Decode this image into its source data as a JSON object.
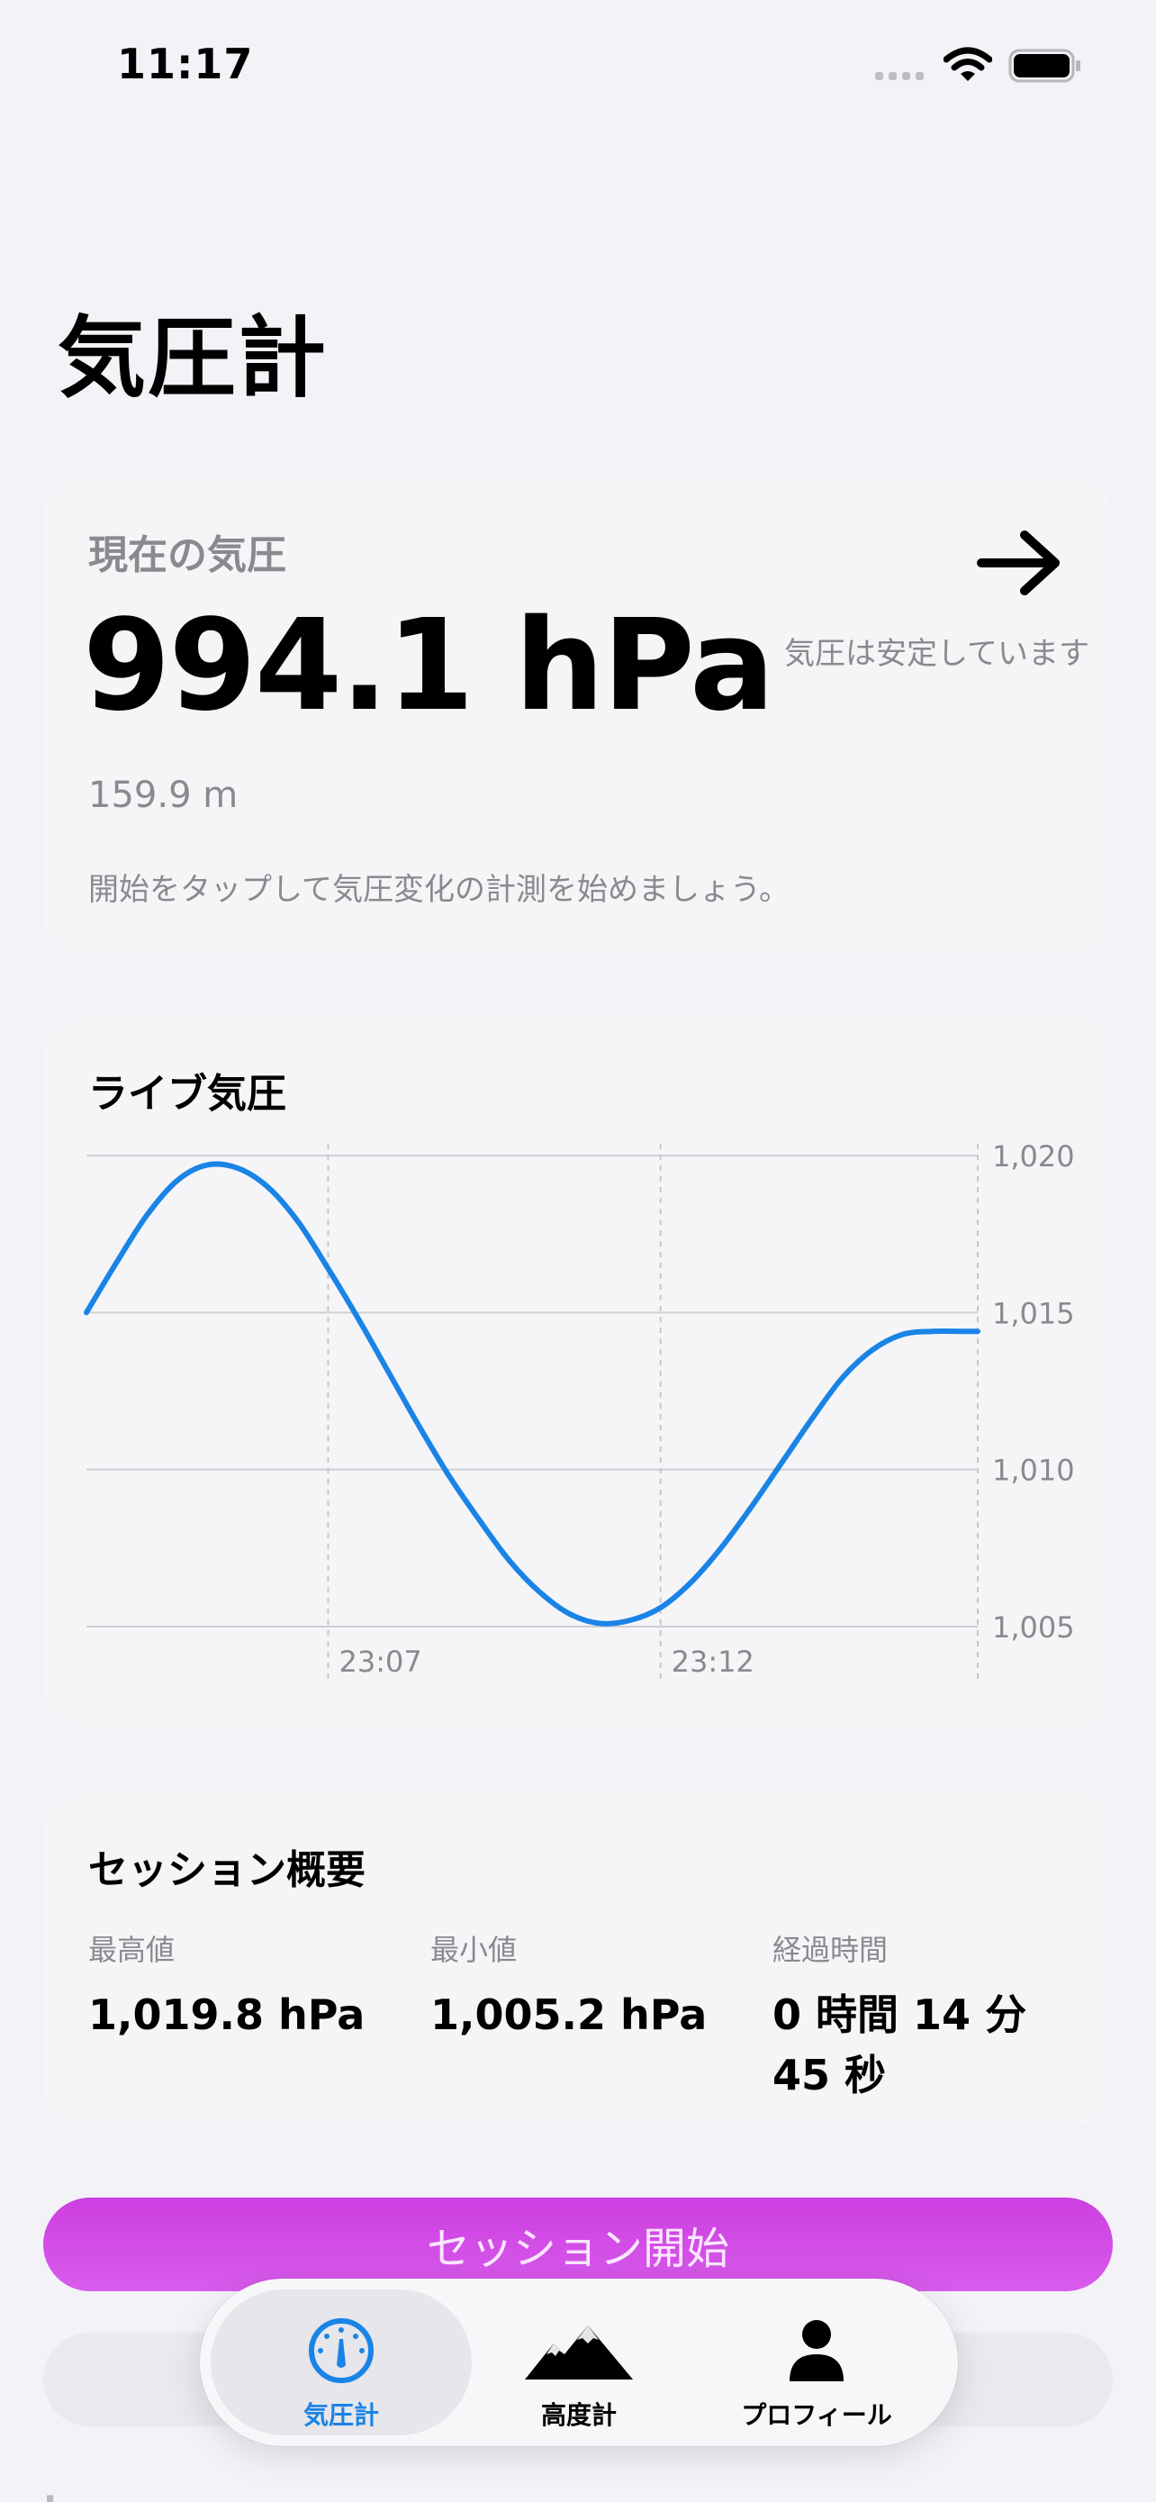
{
  "status_bar": {
    "time": "11:17"
  },
  "page_title": "気圧計",
  "current_card": {
    "label": "現在の気圧",
    "value": "994.1 hPa",
    "altitude": "159.9 m",
    "hint": "開始をタップして気圧変化の計測を始めましょう。",
    "trend_text": "気圧は安定しています",
    "trend_icon": "arrow-right-icon"
  },
  "live_card": {
    "title": "ライブ気圧"
  },
  "chart_data": {
    "type": "line",
    "title": "ライブ気圧",
    "x_tick_labels": [
      "23:07",
      "23:12"
    ],
    "y_ticks": [
      1005,
      1010,
      1015,
      1020
    ],
    "y_tick_labels": [
      "1,005",
      "1,010",
      "1,015",
      "1,020"
    ],
    "ylim": [
      1005,
      1020
    ],
    "grid": true,
    "series_color": "#1a84e6",
    "series": [
      {
        "x": [
          0,
          0.5,
          1,
          1.5,
          2,
          2.5,
          3,
          3.5,
          4,
          4.5,
          5,
          5.5,
          6,
          6.5,
          7,
          7.5,
          8,
          8.5,
          9,
          9.5,
          10,
          10.5,
          11,
          11.5,
          12,
          12.5,
          13,
          13.5,
          14,
          14.5,
          14.75
        ],
        "y": [
          1015.0,
          1016.6,
          1018.1,
          1019.2,
          1019.7,
          1019.6,
          1019.0,
          1017.9,
          1016.4,
          1014.8,
          1013.1,
          1011.4,
          1009.8,
          1008.4,
          1007.1,
          1006.1,
          1005.4,
          1005.1,
          1005.2,
          1005.6,
          1006.4,
          1007.5,
          1008.8,
          1010.2,
          1011.6,
          1012.9,
          1013.8,
          1014.3,
          1014.4,
          1014.4,
          1014.4
        ]
      }
    ]
  },
  "summary_card": {
    "title": "セッション概要",
    "stats": [
      {
        "label": "最高値",
        "value": "1,019.8 hPa"
      },
      {
        "label": "最小値",
        "value": "1,005.2 hPa"
      },
      {
        "label": "経過時間",
        "value_line1": "0 時間 14 分",
        "value_line2": "45 秒"
      }
    ]
  },
  "start_button": {
    "label": "セッション開始",
    "color_start": "#cc3ee0",
    "color_end": "#d85cec"
  },
  "tab_bar": {
    "tabs": [
      {
        "label": "気圧計",
        "icon": "gauge-icon",
        "active": true
      },
      {
        "label": "高度計",
        "icon": "mountains-icon",
        "active": false
      },
      {
        "label": "プロフィール",
        "icon": "person-icon",
        "active": false
      }
    ],
    "accent": "#1a84e6"
  }
}
